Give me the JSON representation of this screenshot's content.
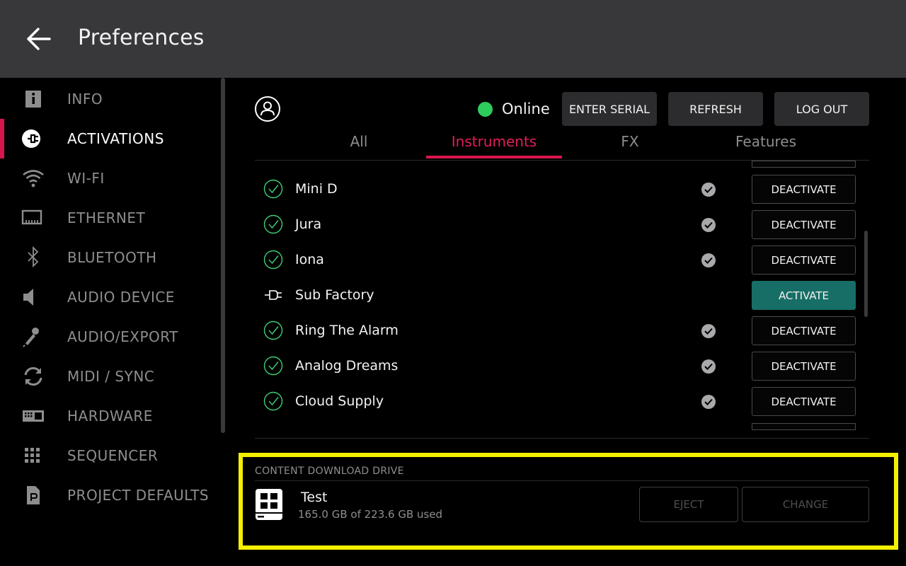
{
  "header": {
    "title": "Preferences",
    "back_icon": "arrow-left-icon"
  },
  "sidebar": {
    "active_color": "#d7164d",
    "items": [
      {
        "label": "INFO",
        "icon": "info-icon"
      },
      {
        "label": "ACTIVATIONS",
        "icon": "plug-icon",
        "active": true
      },
      {
        "label": "WI-FI",
        "icon": "wifi-icon"
      },
      {
        "label": "ETHERNET",
        "icon": "ethernet-icon"
      },
      {
        "label": "BLUETOOTH",
        "icon": "bluetooth-icon"
      },
      {
        "label": "AUDIO DEVICE",
        "icon": "speaker-icon"
      },
      {
        "label": "AUDIO/EXPORT",
        "icon": "microphone-icon"
      },
      {
        "label": "MIDI / SYNC",
        "icon": "sync-icon"
      },
      {
        "label": "HARDWARE",
        "icon": "keyboard-icon"
      },
      {
        "label": "SEQUENCER",
        "icon": "grid-icon"
      },
      {
        "label": "PROJECT DEFAULTS",
        "icon": "document-icon"
      }
    ]
  },
  "account": {
    "user_icon": "user-icon",
    "status": "Online",
    "status_color": "#2ecc5c",
    "buttons": {
      "enter_serial": "ENTER SERIAL",
      "refresh": "REFRESH",
      "log_out": "LOG OUT"
    }
  },
  "tabs": [
    {
      "label": "All"
    },
    {
      "label": "Instruments",
      "active": true
    },
    {
      "label": "FX"
    },
    {
      "label": "Features"
    }
  ],
  "products": [
    {
      "name": "Mini D",
      "activated": true,
      "installed": true,
      "action": "DEACTIVATE"
    },
    {
      "name": "Jura",
      "activated": true,
      "installed": true,
      "action": "DEACTIVATE"
    },
    {
      "name": "Iona",
      "activated": true,
      "installed": true,
      "action": "DEACTIVATE"
    },
    {
      "name": "Sub Factory",
      "activated": false,
      "installed": false,
      "action": "ACTIVATE"
    },
    {
      "name": "Ring The Alarm",
      "activated": true,
      "installed": true,
      "action": "DEACTIVATE"
    },
    {
      "name": "Analog Dreams",
      "activated": true,
      "installed": true,
      "action": "DEACTIVATE"
    },
    {
      "name": "Cloud Supply",
      "activated": true,
      "installed": true,
      "action": "DEACTIVATE"
    }
  ],
  "activate_color": "#176e66",
  "content_drive": {
    "heading": "CONTENT DOWNLOAD DRIVE",
    "name": "Test",
    "usage": "165.0 GB of 223.6 GB used",
    "drive_icon": "drive-icon",
    "eject_label": "EJECT",
    "change_label": "CHANGE",
    "highlight_color": "#f4f000"
  }
}
